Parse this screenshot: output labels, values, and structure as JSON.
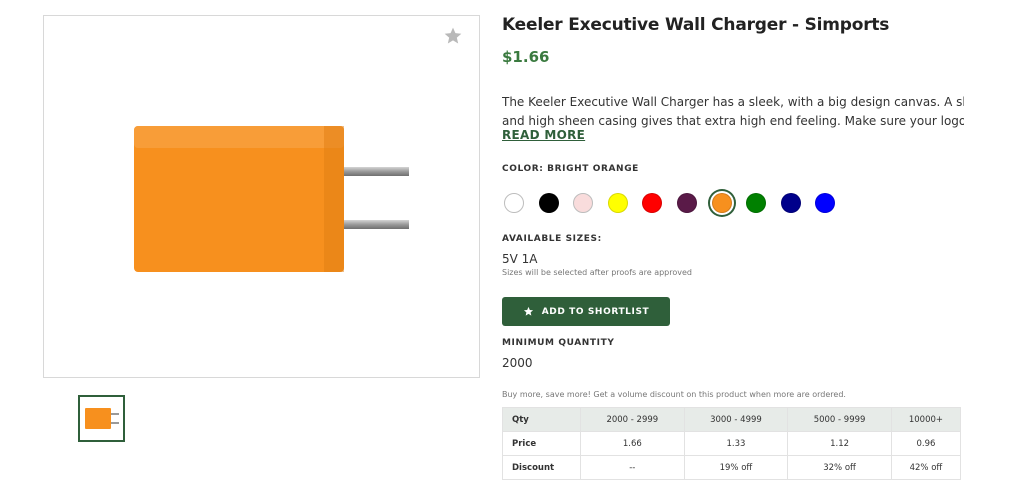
{
  "product": {
    "title": "Keeler Executive Wall Charger - Simports",
    "price": "$1.66",
    "description_lines": [
      "The Keeler Executive Wall Charger has a sleek, with a big design canvas. A slim profile",
      "and high sheen casing gives that extra high end feeling. Make sure your logo always..."
    ],
    "read_more": "READ MORE",
    "product_color": "#f7901e"
  },
  "color": {
    "label": "COLOR: BRIGHT ORANGE",
    "selected": "Bright Orange",
    "swatches": [
      {
        "name": "White",
        "hex": "#ffffff"
      },
      {
        "name": "Black",
        "hex": "#000000"
      },
      {
        "name": "Pink",
        "hex": "#f9dcdc"
      },
      {
        "name": "Yellow",
        "hex": "#ffff00"
      },
      {
        "name": "Red",
        "hex": "#ff0000"
      },
      {
        "name": "Maroon",
        "hex": "#5a1a48"
      },
      {
        "name": "Bright Orange",
        "hex": "#f7901e"
      },
      {
        "name": "Green",
        "hex": "#008000"
      },
      {
        "name": "Navy",
        "hex": "#00008b"
      },
      {
        "name": "Blue",
        "hex": "#0000ff"
      }
    ]
  },
  "sizes": {
    "label": "AVAILABLE SIZES:",
    "value": "5V 1A",
    "note": "Sizes will be selected after proofs are approved"
  },
  "shortlist": {
    "label": "ADD TO SHORTLIST",
    "icon": "star-icon"
  },
  "minimum": {
    "label": "MINIMUM QUANTITY",
    "value": "2000"
  },
  "volume": {
    "note": "Buy more, save more! Get a volume discount on this product when more are ordered.",
    "headers": [
      "Qty",
      "2000 - 2999",
      "3000 - 4999",
      "5000 - 9999",
      "10000+"
    ],
    "rows": [
      [
        "Price",
        "1.66",
        "1.33",
        "1.12",
        "0.96"
      ],
      [
        "Discount",
        "--",
        "19% off",
        "32% off",
        "42% off"
      ]
    ]
  },
  "colors": {
    "accent": "#2f5f3a",
    "price": "#3a7a3f"
  }
}
